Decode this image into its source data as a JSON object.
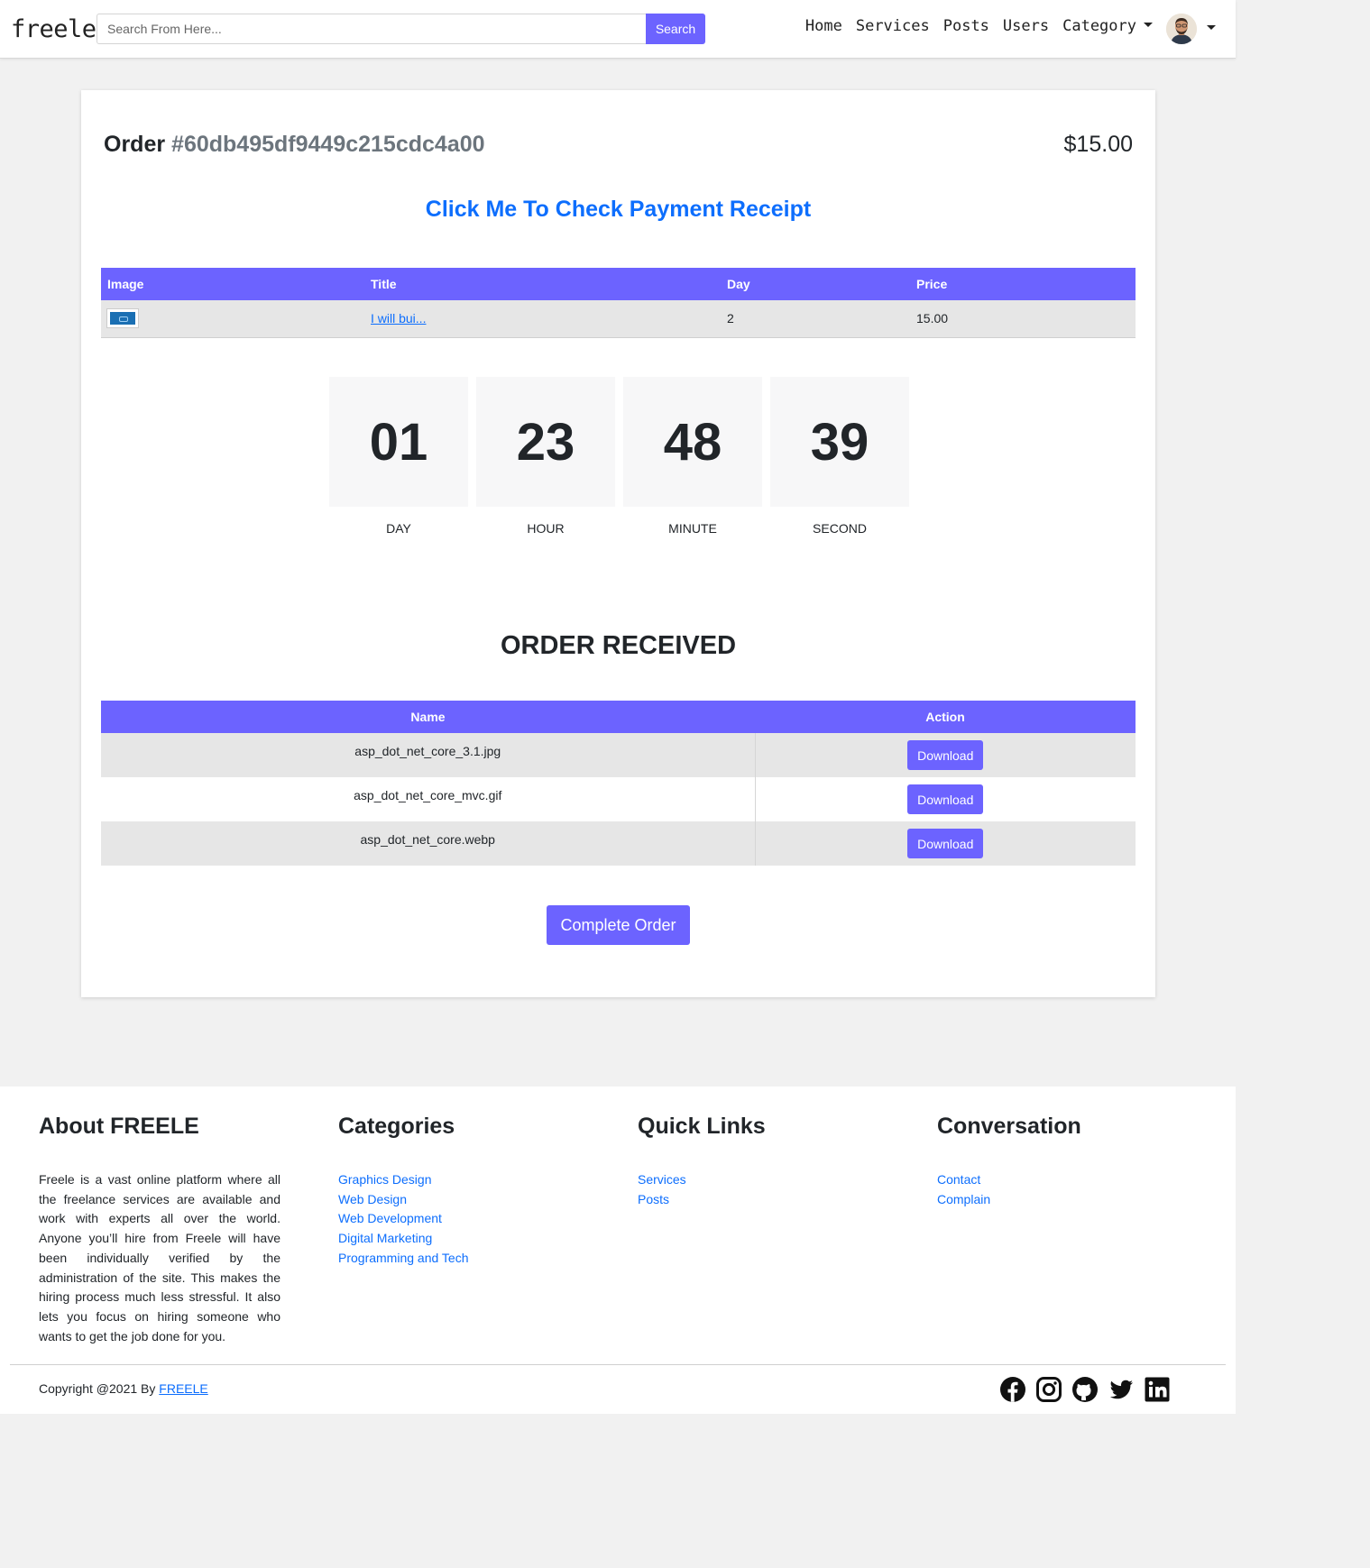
{
  "nav": {
    "brand": "freele",
    "search_placeholder": "Search From Here...",
    "search_button": "Search",
    "links": [
      "Home",
      "Services",
      "Posts",
      "Users",
      "Category"
    ]
  },
  "order": {
    "label": "Order",
    "id": "#60db495df9449c215cdc4a00",
    "price": "$15.00",
    "receipt_link": "Click Me To Check Payment Receipt"
  },
  "items_table": {
    "headers": [
      "Image",
      "Title",
      "Day",
      "Price"
    ],
    "rows": [
      {
        "title": "I will bui...",
        "day": "2",
        "price": "15.00"
      }
    ]
  },
  "countdown": [
    {
      "value": "01",
      "label": "DAY"
    },
    {
      "value": "23",
      "label": "HOUR"
    },
    {
      "value": "48",
      "label": "MINUTE"
    },
    {
      "value": "39",
      "label": "SECOND"
    }
  ],
  "received": {
    "title": "ORDER RECEIVED",
    "headers": [
      "Name",
      "Action"
    ],
    "files": [
      {
        "name": "asp_dot_net_core_3.1.jpg",
        "action": "Download"
      },
      {
        "name": "asp_dot_net_core_mvc.gif",
        "action": "Download"
      },
      {
        "name": "asp_dot_net_core.webp",
        "action": "Download"
      }
    ],
    "complete_button": "Complete Order"
  },
  "footer": {
    "about_title": "About FREELE",
    "about_text": "Freele is a vast online platform where all the freelance services are available and work with experts all over the world. Anyone you’ll hire from Freele will have been individually verified by the administration of the site. This makes the hiring process much less stressful. It also lets you focus on hiring someone who wants to get the job done for you.",
    "categories_title": "Categories",
    "categories": [
      "Graphics Design",
      "Web Design",
      "Web Development",
      "Digital Marketing",
      "Programming and Tech"
    ],
    "quick_title": "Quick Links",
    "quick_links": [
      "Services",
      "Posts"
    ],
    "conversation_title": "Conversation",
    "conversation_links": [
      "Contact",
      "Complain"
    ],
    "copyright_prefix": "Copyright @2021 By",
    "copyright_link": "FREELE",
    "social_icons": [
      "facebook-icon",
      "instagram-icon",
      "github-icon",
      "twitter-icon",
      "linkedin-icon"
    ]
  },
  "colors": {
    "accent": "#6c63ff",
    "link": "#0d6efd"
  }
}
